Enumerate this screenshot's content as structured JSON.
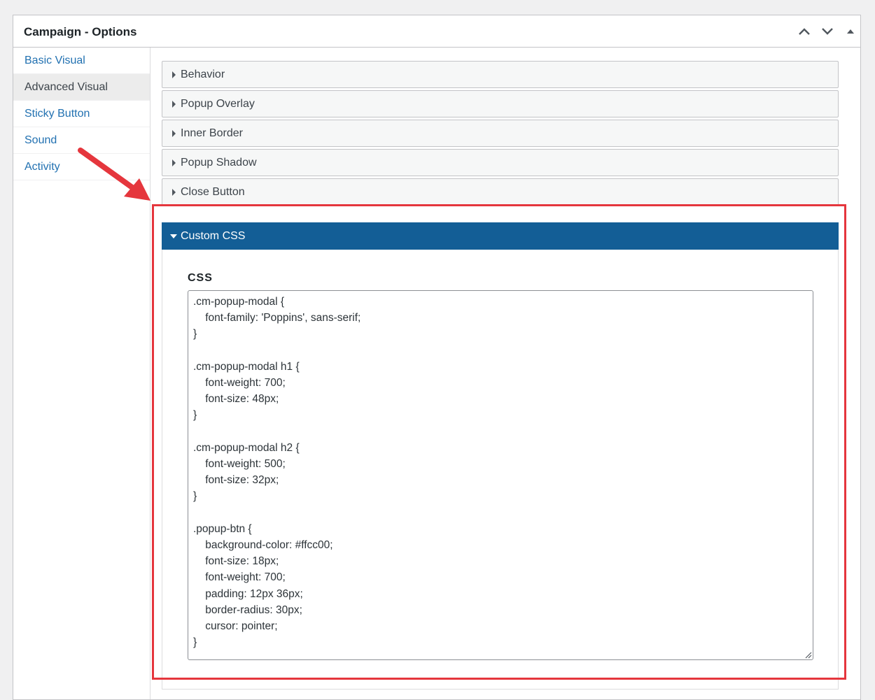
{
  "panel": {
    "title": "Campaign - Options",
    "header_buttons": [
      {
        "name": "move-up-button",
        "icon": "chevron-up-icon"
      },
      {
        "name": "move-down-button",
        "icon": "chevron-down-icon"
      },
      {
        "name": "collapse-toggle-button",
        "icon": "caret-up-icon"
      }
    ]
  },
  "sidebar": {
    "items": [
      {
        "label": "Basic Visual",
        "active": false
      },
      {
        "label": "Advanced Visual",
        "active": true
      },
      {
        "label": "Sticky Button",
        "active": false
      },
      {
        "label": "Sound",
        "active": false
      },
      {
        "label": "Activity",
        "active": false
      }
    ]
  },
  "accordion": {
    "sections": [
      {
        "label": "Behavior",
        "expanded": false
      },
      {
        "label": "Popup Overlay",
        "expanded": false
      },
      {
        "label": "Inner Border",
        "expanded": false
      },
      {
        "label": "Popup Shadow",
        "expanded": false
      },
      {
        "label": "Close Button",
        "expanded": false
      },
      {
        "label": "Custom CSS",
        "expanded": true
      }
    ]
  },
  "custom_css": {
    "field_label": "CSS",
    "value": ".cm-popup-modal {\n    font-family: 'Poppins', sans-serif;\n}\n\n.cm-popup-modal h1 {\n    font-weight: 700;\n    font-size: 48px;\n}\n\n.cm-popup-modal h2 {\n    font-weight: 500;\n    font-size: 32px;\n}\n\n.popup-btn {\n    background-color: #ffcc00;\n    font-size: 18px;\n    font-weight: 700;\n    padding: 12px 36px;\n    border-radius: 30px;\n    cursor: pointer;\n}"
  },
  "colors": {
    "accent": "#135e96",
    "link": "#2271b1",
    "highlight": "#e5363d"
  }
}
